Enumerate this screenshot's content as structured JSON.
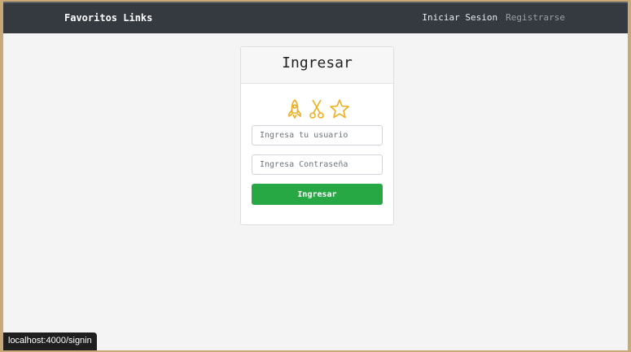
{
  "navbar": {
    "brand": "Favoritos Links",
    "links": [
      "Iniciar Sesion",
      "Registrarse"
    ]
  },
  "card": {
    "title": "Ingresar",
    "icons": [
      "rocket-icon",
      "scissors-icon",
      "star-icon"
    ],
    "username_placeholder": "Ingresa tu usuario",
    "password_placeholder": "Ingresa Contraseña",
    "submit_label": "Ingresar"
  },
  "status_bar": {
    "url": "localhost:4000/signin"
  },
  "colors": {
    "navbar_bg": "#343a40",
    "accent_icons": "#f0ad1e",
    "submit_bg": "#28a745"
  }
}
